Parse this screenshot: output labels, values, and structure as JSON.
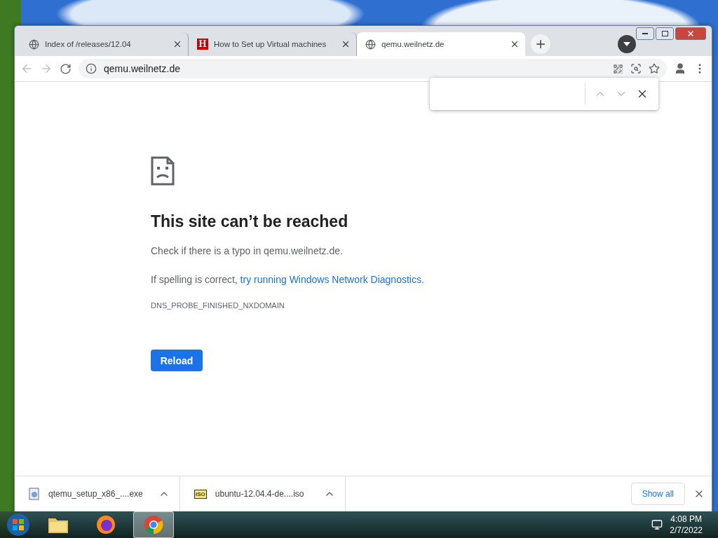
{
  "tabs": [
    {
      "title": "Index of /releases/12.04",
      "selected": false,
      "favicon": {
        "kind": "globe"
      }
    },
    {
      "title": "How to Set up Virtual machines",
      "selected": false,
      "favicon": {
        "kind": "letter",
        "text": "H"
      }
    },
    {
      "title": "qemu.weilnetz.de",
      "selected": true,
      "favicon": {
        "kind": "globe"
      }
    }
  ],
  "address": "qemu.weilnetz.de",
  "find_bar": {
    "open": true
  },
  "error": {
    "title": "This site can’t be reached",
    "line_1": "Check if there is a typo in qemu.weilnetz.de.",
    "line_2": {
      "before": "If spelling is correct, ",
      "link": "try running Windows Network Diagnostics",
      "after": "."
    },
    "code": "DNS_PROBE_FINISHED_NXDOMAIN",
    "button": "Reload"
  },
  "downloads": [
    {
      "name": "qtemu_setup_x86_....exe",
      "kind": "exe"
    },
    {
      "name": "ubuntu-12.04.4-de....iso",
      "kind": "iso",
      "badge": "ISO"
    }
  ],
  "show_all": "Show all",
  "taskbar": {
    "apps": [
      {
        "kind": "folder",
        "selected": false
      },
      {
        "kind": "firefox",
        "selected": false
      },
      {
        "kind": "chrome",
        "selected": true
      }
    ],
    "time": "4:08 PM",
    "date": "2/7/2022"
  }
}
